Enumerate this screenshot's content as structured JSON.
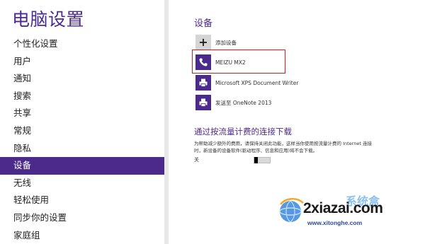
{
  "sidebar": {
    "title": "电脑设置",
    "items": [
      {
        "label": "个性化设置",
        "active": false
      },
      {
        "label": "用户",
        "active": false
      },
      {
        "label": "通知",
        "active": false
      },
      {
        "label": "搜索",
        "active": false
      },
      {
        "label": "共享",
        "active": false
      },
      {
        "label": "常规",
        "active": false
      },
      {
        "label": "隐私",
        "active": false
      },
      {
        "label": "设备",
        "active": true
      },
      {
        "label": "无线",
        "active": false
      },
      {
        "label": "轻松使用",
        "active": false
      },
      {
        "label": "同步你的设置",
        "active": false
      },
      {
        "label": "家庭组",
        "active": false
      }
    ]
  },
  "main": {
    "section_title": "设备",
    "add_device_label": "添加设备",
    "devices": [
      {
        "label": "MEIZU MX2",
        "icon": "phone-icon"
      },
      {
        "label": "Microsoft XPS Document Writer",
        "icon": "printer-icon"
      },
      {
        "label": "发送至 OneNote 2013",
        "icon": "printer-icon"
      }
    ],
    "metered_title": "通过按流量计费的连接下载",
    "metered_desc": "为帮助减少额外的费用，请保持关闭此功能，这样当你使用按流量计费的 Internet 连接时，新设备的设备软件(驱动程序、信息和应用)将不会下载。",
    "toggle_label": "关",
    "toggle_on": false
  },
  "watermark": {
    "text": "2xiazai.com",
    "cn_text": "系统盒",
    "url": "www.xitonghe.com"
  },
  "colors": {
    "accent": "#4b2a8c",
    "highlight_border": "#d61c1c"
  }
}
